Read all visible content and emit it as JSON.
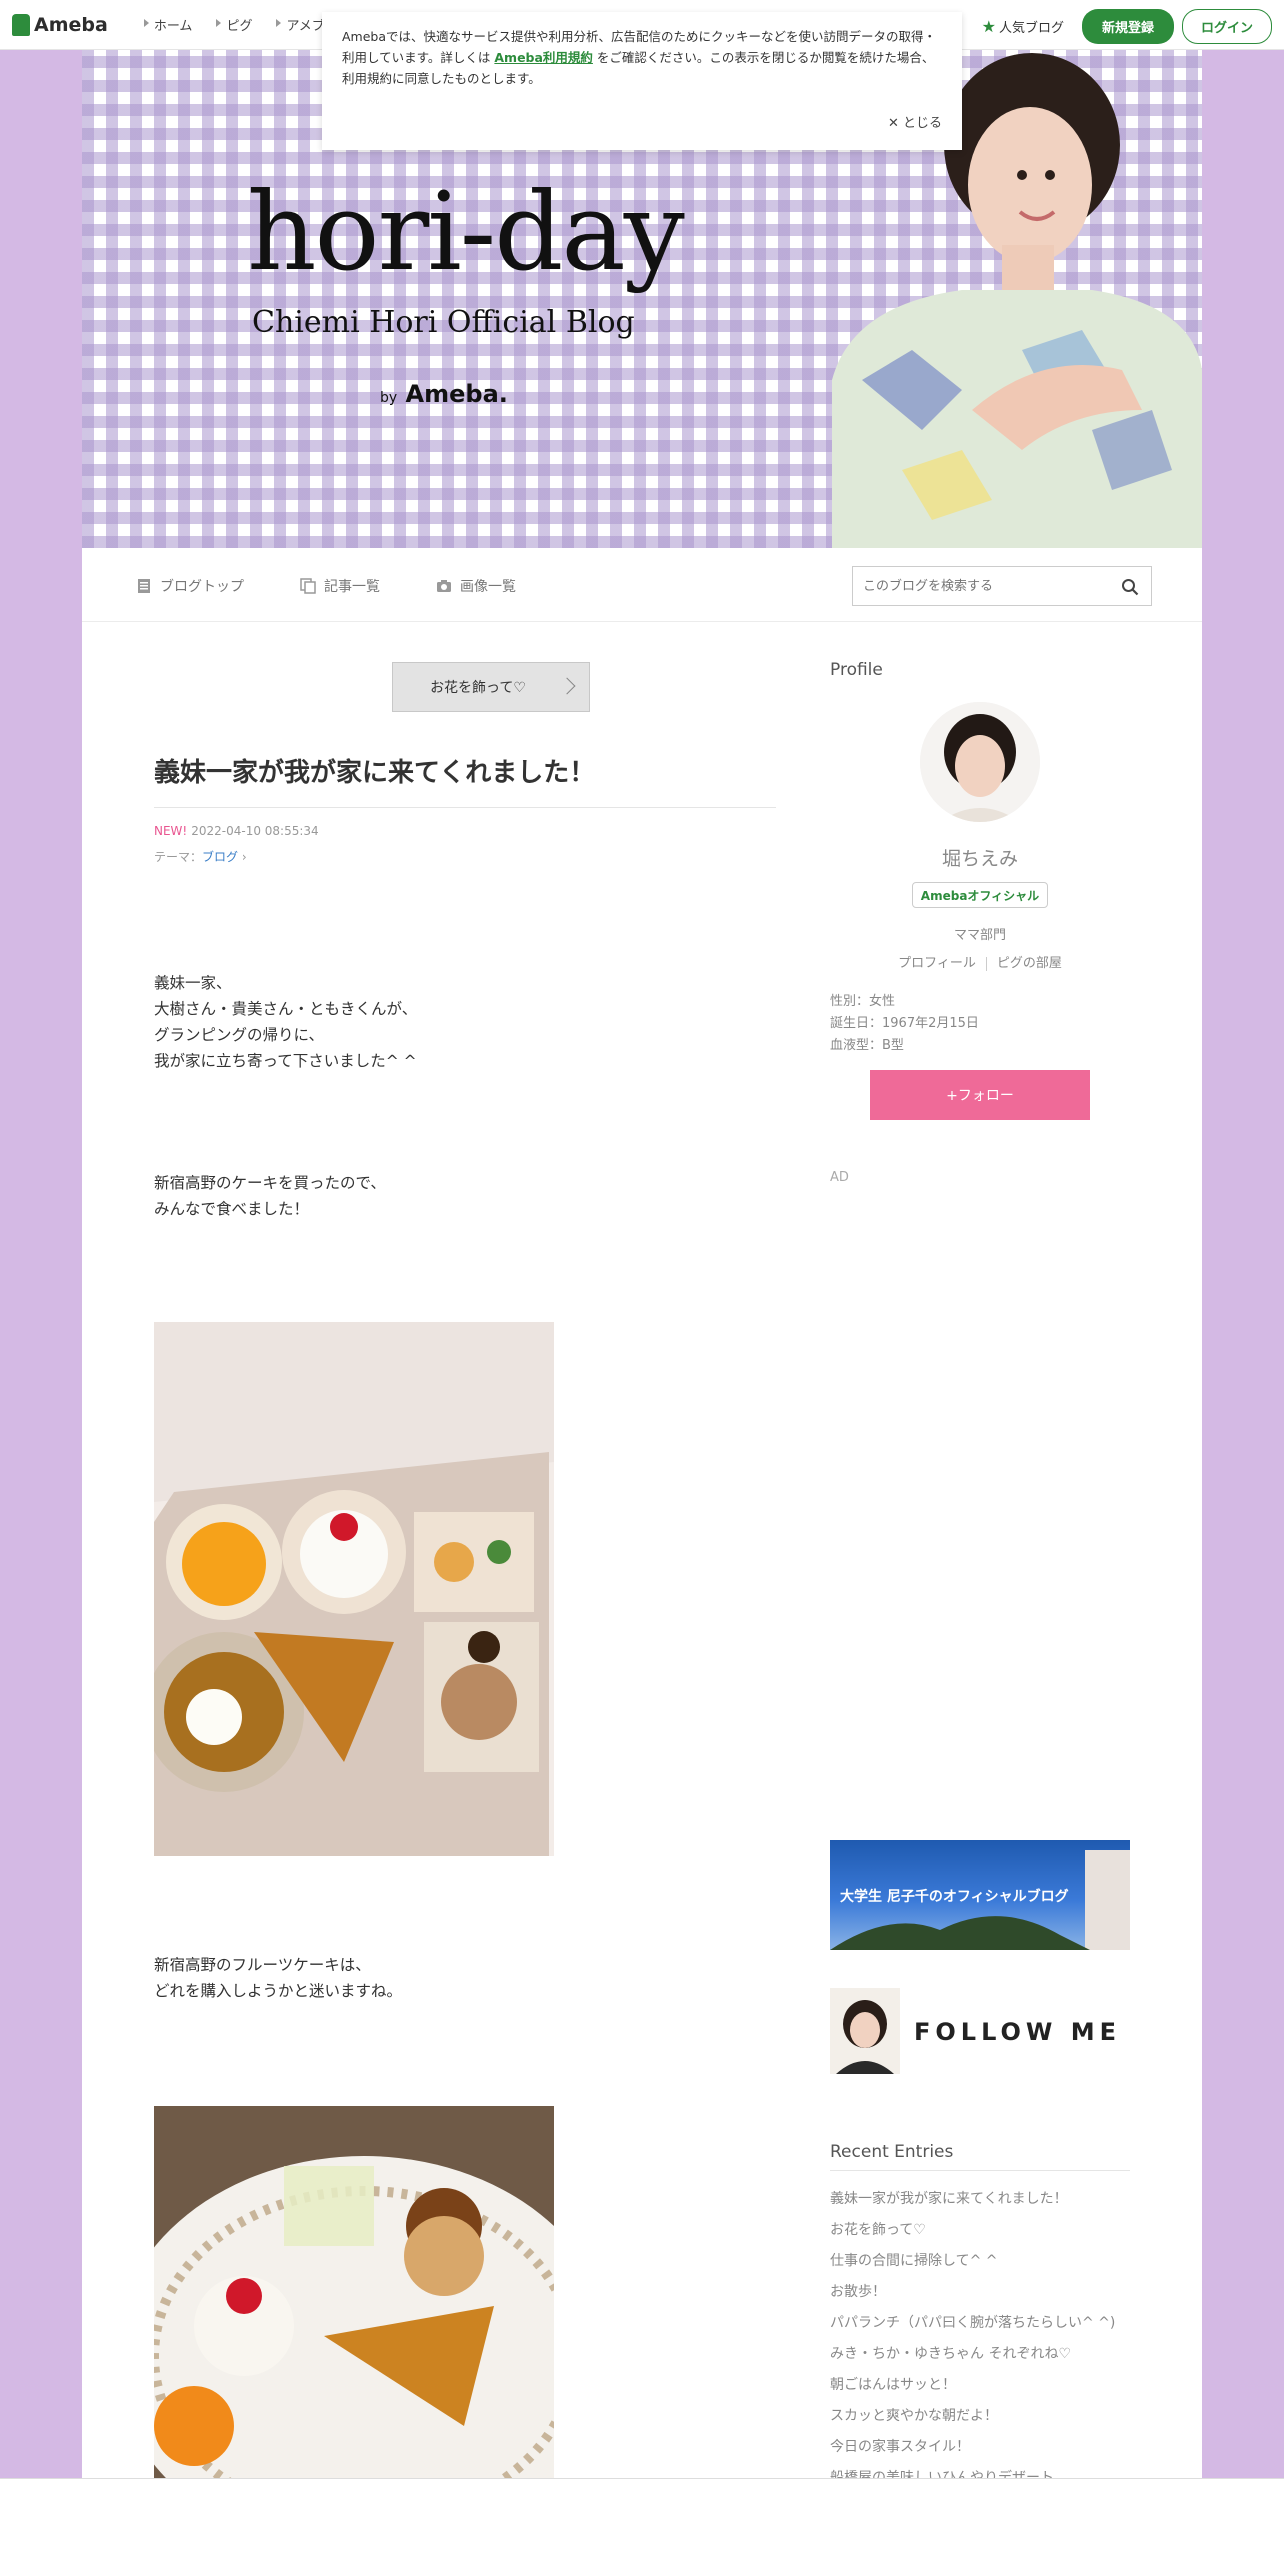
{
  "topbar": {
    "logo": "Ameba",
    "nav": [
      "ホーム",
      "ピグ",
      "アメブロ"
    ],
    "popular": "人気ブログ",
    "register": "新規登録",
    "login": "ログイン"
  },
  "cookie": {
    "text_before": "Amebaでは、快適なサービス提供や利用分析、広告配信のためにクッキーなどを使い訪問データの取得・利用しています。詳しくは",
    "link": "Ameba利用規約",
    "text_after": "をご確認ください。この表示を閉じるか閲覧を続けた場合、利用規約に同意したものとします。",
    "close": "とじる"
  },
  "header": {
    "title": "hori-day",
    "subtitle": "Chiemi Hori Official Blog",
    "by": "by",
    "brand": "Ameba."
  },
  "menu": {
    "top": "ブログトップ",
    "entries": "記事一覧",
    "images": "画像一覧",
    "search_placeholder": "このブログを検索する"
  },
  "entry": {
    "prev": "お花を飾って♡",
    "title": "義妹一家が我が家に来てくれました！",
    "new_label": "NEW!",
    "date": "2022-04-10 08:55:34",
    "theme_label": "テーマ：",
    "theme": "ブログ",
    "p1": "義妹一家、\n大樹さん・貴美さん・ともきくんが、\nグランピングの帰りに、\n我が家に立ち寄って下さいました^ ^",
    "p2": "新宿高野のケーキを買ったので、\nみんなで食べました！",
    "p3": "新宿高野のフルーツケーキは、\nどれを購入しようかと迷いますね。"
  },
  "sidebar": {
    "profile_heading": "Profile",
    "name": "堀ちえみ",
    "badge": "Amebaオフィシャル",
    "dept": "ママ部門",
    "profile_link": "プロフィール",
    "pigg_link": "ピグの部屋",
    "gender": "性別：女性",
    "birthday": "誕生日：1967年2月15日",
    "blood": "血液型：B型",
    "follow": "+フォロー",
    "ad": "AD",
    "banner_text": "大学生 尼子千のオフィシャルブログ",
    "follow_me": "FOLLOW ME",
    "recent_heading": "Recent Entries",
    "recent": [
      "義妹一家が我が家に来てくれました！",
      "お花を飾って♡",
      "仕事の合間に掃除して^ ^",
      "お散歩！",
      "パパランチ（パパ曰く腕が落ちたらしい^ ^)",
      "みき・ちか・ゆきちゃん それぞれね♡",
      "朝ごはんはサッと！",
      "スカッと爽やかな朝だよ！",
      "今日の家事スタイル！",
      "船橋屋の美味しいひんやりデザート"
    ]
  },
  "colors": {
    "ameba_green": "#2d8c3c",
    "follow_pink": "#ef6a98",
    "page_bg": "#d4b9e4"
  }
}
